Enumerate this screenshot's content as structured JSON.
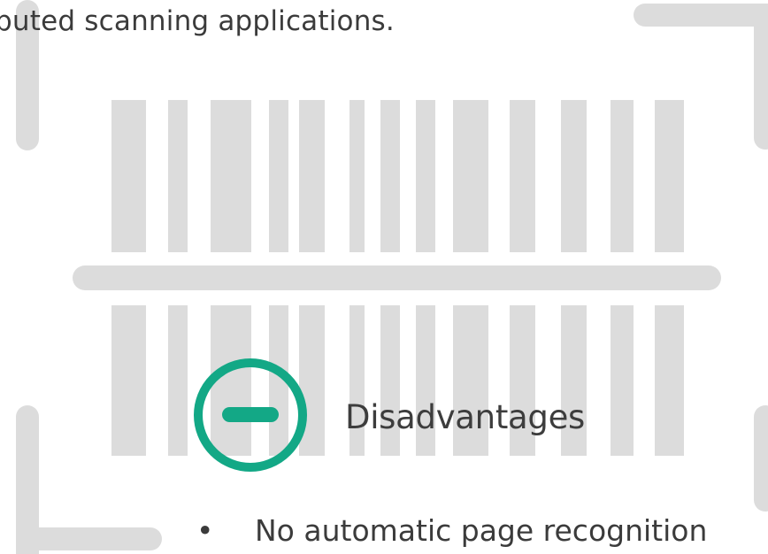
{
  "intro_text": "buted scanning applications.",
  "section": {
    "title": "Disadvantages",
    "icon": "minus-circle-icon",
    "accent_color": "#13a886"
  },
  "bullets": [
    {
      "marker": "•",
      "text": "No automatic page recognition"
    }
  ],
  "background": {
    "icon": "barcode-scan-icon",
    "color": "#dcdcdc"
  }
}
